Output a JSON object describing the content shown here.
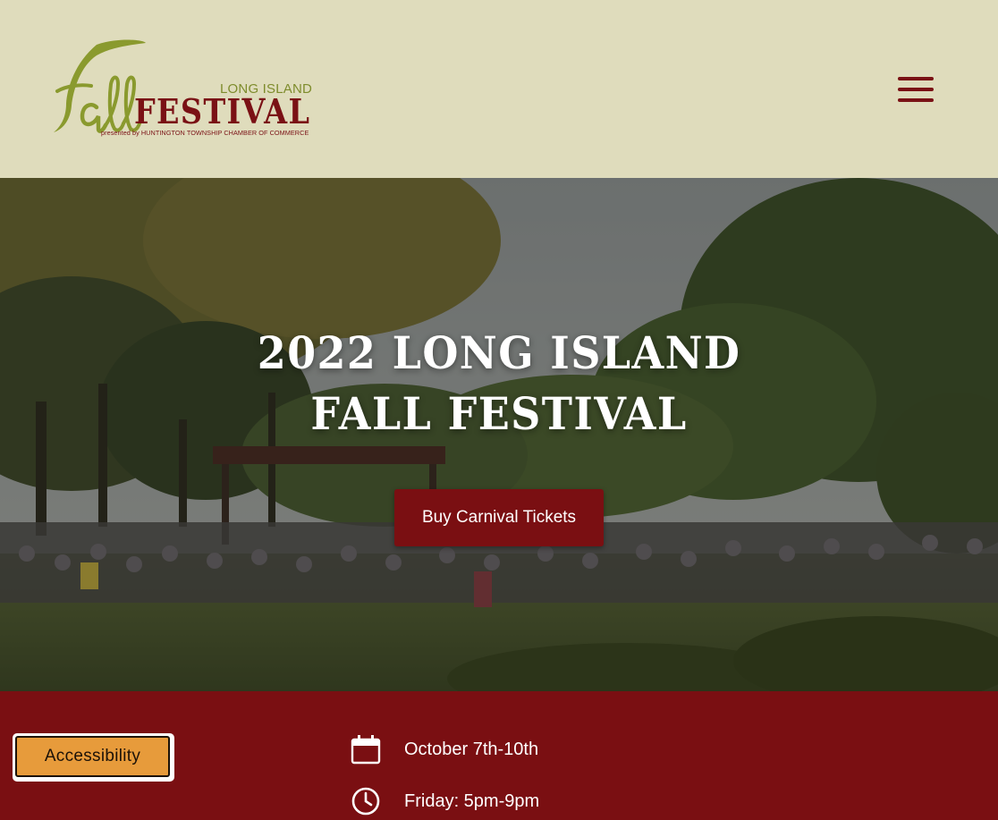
{
  "header": {
    "logo": {
      "script_word": "Fall",
      "long_island": "LONG ISLAND",
      "festival": "FESTIVAL",
      "presented_by": "presented by HUNTINGTON TOWNSHIP CHAMBER OF COMMERCE"
    },
    "menu_icon": "hamburger-menu-icon"
  },
  "hero": {
    "title_line1": "2022 LONG ISLAND",
    "title_line2": "FALL FESTIVAL",
    "cta_label": "Buy Carnival Tickets"
  },
  "info": {
    "accessibility_label": "Accessibility",
    "dates": {
      "icon": "calendar-icon",
      "text": "October 7th-10th"
    },
    "hours": {
      "icon": "clock-icon",
      "text": "Friday: 5pm-9pm"
    }
  },
  "colors": {
    "header_bg": "#dfdcbc",
    "brand_red": "#7a0f12",
    "logo_green": "#7e8c2c",
    "accessibility_orange": "#e79b3b"
  }
}
